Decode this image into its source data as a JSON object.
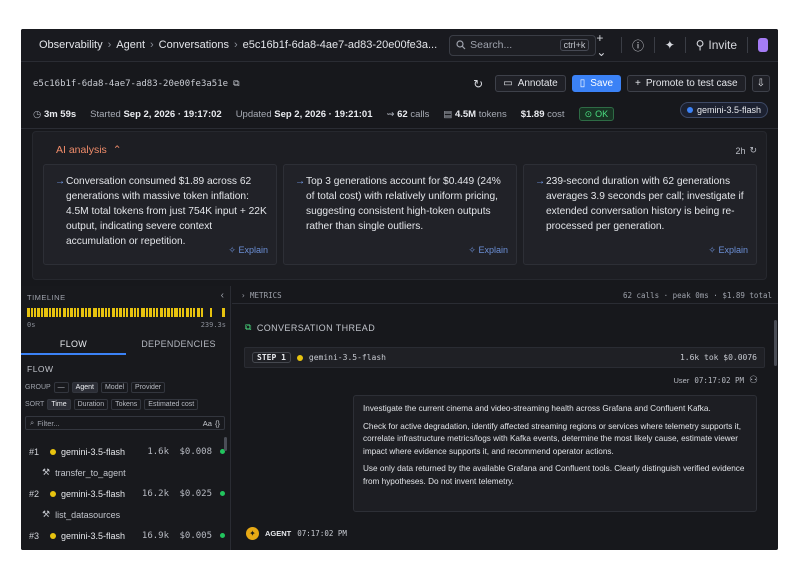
{
  "breadcrumb": [
    "Observability",
    "Agent",
    "Conversations",
    "e5c16b1f-6da8-4ae7-ad83-20e00fe3a..."
  ],
  "search": {
    "placeholder": "Search...",
    "shortcut": "ctrl+k"
  },
  "topbar": {
    "invite_label": "Invite"
  },
  "conversation": {
    "id": "e5c16b1f-6da8-4ae7-ad83-20e00fe3a51e",
    "duration": "3m 59s",
    "started_label": "Started",
    "started": "Sep 2, 2026 · 19:17:02",
    "updated_label": "Updated",
    "updated": "Sep 2, 2026 · 19:21:01",
    "calls_value": "62",
    "calls_label": "calls",
    "tokens_value": "4.5M",
    "tokens_label": "tokens",
    "cost_value": "$1.89",
    "cost_label": "cost",
    "status": "OK",
    "model": "gemini-3.5-flash"
  },
  "actions": {
    "annotate": "Annotate",
    "save": "Save",
    "promote": "Promote to test case"
  },
  "ai_analysis": {
    "title": "AI analysis",
    "age": "2h",
    "explain_label": "Explain",
    "cards": [
      "Conversation consumed $1.89 across 62 generations with massive token inflation: 4.5M total tokens from just 754K input + 22K output, indicating severe context accumulation or repetition.",
      "Top 3 generations account for $0.449 (24% of total cost) with relatively uniform pricing, suggesting consistent high-token outputs rather than single outliers.",
      "239-second duration with 62 generations averages 3.9 seconds per call; investigate if extended conversation history is being re-processed per generation."
    ]
  },
  "timeline": {
    "label": "TIMELINE",
    "start": "0s",
    "end": "239.3s"
  },
  "tabs": [
    "FLOW",
    "DEPENDENCIES"
  ],
  "flow": {
    "header": "FLOW",
    "group_label": "GROUP",
    "group_options": [
      "—",
      "Agent",
      "Model",
      "Provider"
    ],
    "sort_label": "SORT",
    "sort_options": [
      "Time",
      "Duration",
      "Tokens",
      "Estimated cost"
    ],
    "filter_placeholder": "Filter...",
    "filter_case": "Aa",
    "filter_regex": "{}",
    "items": [
      {
        "num": "#1",
        "model": "gemini-3.5-flash",
        "tokens": "1.6k",
        "cost": "$0.008",
        "tool": "transfer_to_agent"
      },
      {
        "num": "#2",
        "model": "gemini-3.5-flash",
        "tokens": "16.2k",
        "cost": "$0.025",
        "tool": "list_datasources"
      },
      {
        "num": "#3",
        "model": "gemini-3.5-flash",
        "tokens": "16.9k",
        "cost": "$0.005",
        "tool": ""
      }
    ]
  },
  "metrics": {
    "label": "METRICS",
    "summary": "62 calls · peak 0ms · $1.89 total"
  },
  "thread": {
    "title": "CONVERSATION THREAD",
    "step_label": "STEP 1",
    "step_model": "gemini-3.5-flash",
    "step_stats": "1.6k tok  $0.0076",
    "user_label": "User",
    "user_time": "07:17:02 PM",
    "message": [
      "Investigate the current cinema and video-streaming health across Grafana and Confluent Kafka.",
      "Check for active degradation, identify affected streaming regions or services where telemetry supports it, correlate infrastructure metrics/logs with Kafka events, determine the most likely cause, estimate viewer impact where evidence supports it, and recommend operator actions.",
      "Use only data returned by the available Grafana and Confluent tools. Clearly distinguish verified evidence from hypotheses. Do not invent telemetry."
    ],
    "agent_label": "AGENT",
    "agent_time": "07:17:02 PM"
  },
  "colors": {
    "accent": "#3b82f6",
    "warning": "#e7c30f",
    "ok": "#22c55e",
    "ai": "#f08c6a"
  }
}
